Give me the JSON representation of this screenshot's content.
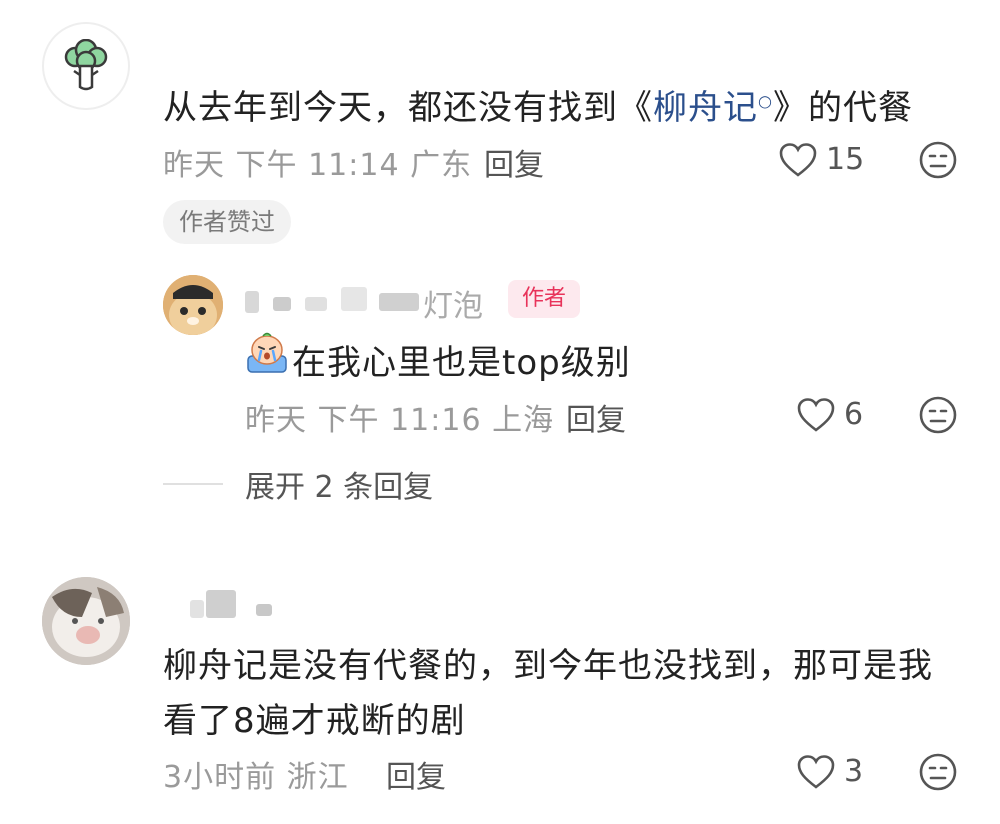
{
  "comments": [
    {
      "text_before": "从去年到今天，都还没有找到《",
      "link_text": "柳舟记",
      "text_after": "》的代餐",
      "time": "昨天 下午 11:14 广东",
      "reply_label": "回复",
      "likes": "15",
      "liked_badge": "作者赞过"
    },
    {
      "username": "灯泡",
      "author_tag": "作者",
      "text": "在我心里也是top级别",
      "time": "昨天 下午 11:16 上海",
      "reply_label": "回复",
      "likes": "6"
    },
    {
      "text_line1": "柳舟记是没有代餐的，到今年也没找到，那可是我",
      "text_line2": "看了8遍才戒断的剧",
      "time": "3小时前 浙江",
      "reply_label": "回复",
      "likes": "3"
    }
  ],
  "expand_replies": "展开 2 条回复",
  "icons": {
    "like": "heart-outline-icon",
    "dislike": "neutral-face-icon",
    "search": "search-mark-icon"
  },
  "colors": {
    "author_tag_bg": "#fde9ee",
    "author_tag_text": "#e8335a",
    "link": "#2b4f8c"
  }
}
